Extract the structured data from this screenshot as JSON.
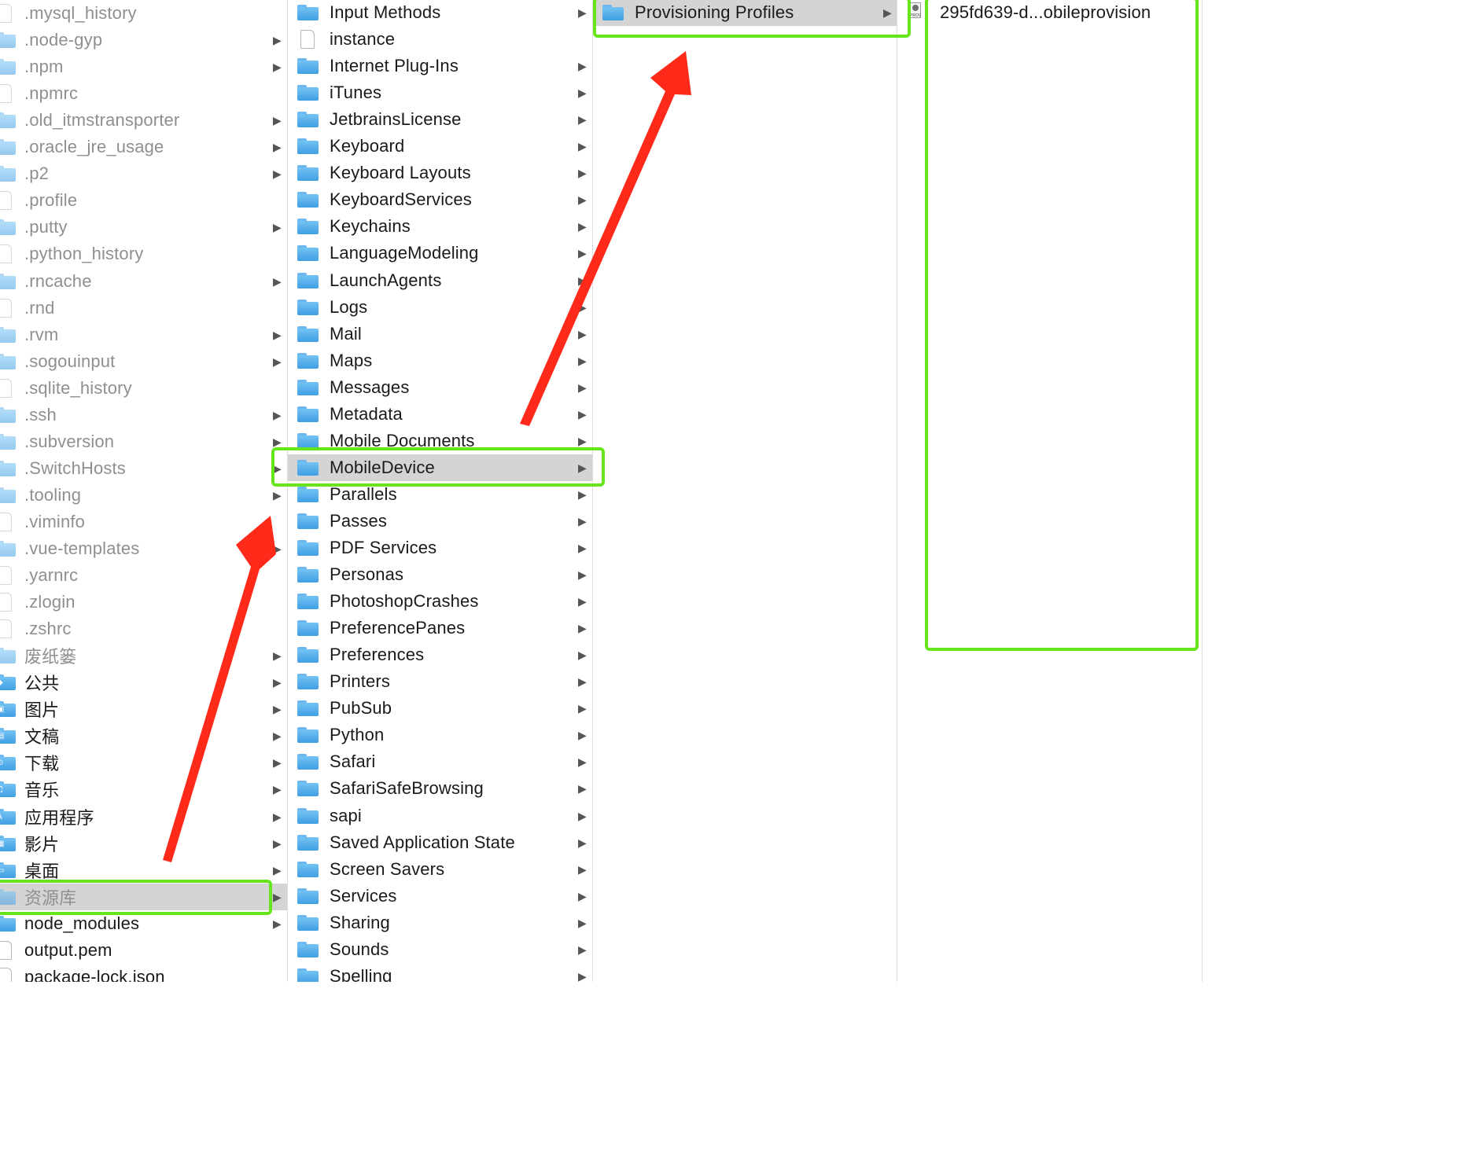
{
  "colors": {
    "highlight_box": "#67e51c",
    "annotation_arrow": "#ff2a1a",
    "selection_background": "#d4d4d4",
    "folder_blue": "#4aa8ea",
    "hidden_item_text": "#8f8f8f"
  },
  "columns": [
    {
      "name": "home-column",
      "items": [
        {
          "label": ".mysql_history",
          "kind": "file",
          "hidden": true,
          "chevron": false
        },
        {
          "label": ".node-gyp",
          "kind": "folder",
          "hidden": true,
          "chevron": true
        },
        {
          "label": ".npm",
          "kind": "folder",
          "hidden": true,
          "chevron": true
        },
        {
          "label": ".npmrc",
          "kind": "file",
          "hidden": true,
          "chevron": false
        },
        {
          "label": ".old_itmstransporter",
          "kind": "folder",
          "hidden": true,
          "chevron": true
        },
        {
          "label": ".oracle_jre_usage",
          "kind": "folder",
          "hidden": true,
          "chevron": true
        },
        {
          "label": ".p2",
          "kind": "folder",
          "hidden": true,
          "chevron": true
        },
        {
          "label": ".profile",
          "kind": "file",
          "hidden": true,
          "chevron": false
        },
        {
          "label": ".putty",
          "kind": "folder",
          "hidden": true,
          "chevron": true
        },
        {
          "label": ".python_history",
          "kind": "file",
          "hidden": true,
          "chevron": false
        },
        {
          "label": ".rncache",
          "kind": "folder",
          "hidden": true,
          "chevron": true
        },
        {
          "label": ".rnd",
          "kind": "file",
          "hidden": true,
          "chevron": false
        },
        {
          "label": ".rvm",
          "kind": "folder",
          "hidden": true,
          "chevron": true
        },
        {
          "label": ".sogouinput",
          "kind": "folder",
          "hidden": true,
          "chevron": true
        },
        {
          "label": ".sqlite_history",
          "kind": "file",
          "hidden": true,
          "chevron": false
        },
        {
          "label": ".ssh",
          "kind": "folder",
          "hidden": true,
          "chevron": true
        },
        {
          "label": ".subversion",
          "kind": "folder",
          "hidden": true,
          "chevron": true
        },
        {
          "label": ".SwitchHosts",
          "kind": "folder",
          "hidden": true,
          "chevron": true
        },
        {
          "label": ".tooling",
          "kind": "folder",
          "hidden": true,
          "chevron": true
        },
        {
          "label": ".viminfo",
          "kind": "file",
          "hidden": true,
          "chevron": false
        },
        {
          "label": ".vue-templates",
          "kind": "folder",
          "hidden": true,
          "chevron": true
        },
        {
          "label": ".yarnrc",
          "kind": "file",
          "hidden": true,
          "chevron": false
        },
        {
          "label": ".zlogin",
          "kind": "file",
          "hidden": true,
          "chevron": false
        },
        {
          "label": ".zshrc",
          "kind": "file",
          "hidden": true,
          "chevron": false
        },
        {
          "label": "废纸篓",
          "kind": "folder",
          "hidden": true,
          "chevron": true
        },
        {
          "label": "公共",
          "kind": "folder",
          "hidden": false,
          "chevron": true,
          "badge": "◆"
        },
        {
          "label": "图片",
          "kind": "folder",
          "hidden": false,
          "chevron": true,
          "badge": "▣"
        },
        {
          "label": "文稿",
          "kind": "folder",
          "hidden": false,
          "chevron": true,
          "badge": "▤"
        },
        {
          "label": "下载",
          "kind": "folder",
          "hidden": false,
          "chevron": true,
          "badge": "⊙"
        },
        {
          "label": "音乐",
          "kind": "folder",
          "hidden": false,
          "chevron": true,
          "badge": "♫"
        },
        {
          "label": "应用程序",
          "kind": "folder",
          "hidden": false,
          "chevron": true,
          "badge": "A"
        },
        {
          "label": "影片",
          "kind": "folder",
          "hidden": false,
          "chevron": true,
          "badge": "▦"
        },
        {
          "label": "桌面",
          "kind": "folder",
          "hidden": false,
          "chevron": true,
          "badge": "▭"
        },
        {
          "label": "资源库",
          "kind": "folder",
          "hidden": true,
          "chevron": true,
          "selected": true
        },
        {
          "label": "node_modules",
          "kind": "folder",
          "hidden": false,
          "chevron": true
        },
        {
          "label": "output.pem",
          "kind": "file",
          "hidden": false,
          "chevron": false
        },
        {
          "label": "package-lock.json",
          "kind": "file",
          "hidden": false,
          "chevron": false
        }
      ]
    },
    {
      "name": "library-column",
      "items": [
        {
          "label": "Input Methods",
          "kind": "folder",
          "chevron": true
        },
        {
          "label": "instance",
          "kind": "file",
          "chevron": false
        },
        {
          "label": "Internet Plug-Ins",
          "kind": "folder",
          "chevron": true
        },
        {
          "label": "iTunes",
          "kind": "folder",
          "chevron": true
        },
        {
          "label": "JetbrainsLicense",
          "kind": "folder",
          "chevron": true
        },
        {
          "label": "Keyboard",
          "kind": "folder",
          "chevron": true
        },
        {
          "label": "Keyboard Layouts",
          "kind": "folder",
          "chevron": true
        },
        {
          "label": "KeyboardServices",
          "kind": "folder",
          "chevron": true
        },
        {
          "label": "Keychains",
          "kind": "folder",
          "chevron": true
        },
        {
          "label": "LanguageModeling",
          "kind": "folder",
          "chevron": true
        },
        {
          "label": "LaunchAgents",
          "kind": "folder",
          "chevron": true
        },
        {
          "label": "Logs",
          "kind": "folder",
          "chevron": true
        },
        {
          "label": "Mail",
          "kind": "folder",
          "chevron": true
        },
        {
          "label": "Maps",
          "kind": "folder",
          "chevron": true
        },
        {
          "label": "Messages",
          "kind": "folder",
          "chevron": true
        },
        {
          "label": "Metadata",
          "kind": "folder",
          "chevron": true
        },
        {
          "label": "Mobile Documents",
          "kind": "folder",
          "chevron": true
        },
        {
          "label": "MobileDevice",
          "kind": "folder",
          "chevron": true,
          "selected": true
        },
        {
          "label": "Parallels",
          "kind": "folder",
          "chevron": true
        },
        {
          "label": "Passes",
          "kind": "folder",
          "chevron": true
        },
        {
          "label": "PDF Services",
          "kind": "folder",
          "chevron": true
        },
        {
          "label": "Personas",
          "kind": "folder",
          "chevron": true
        },
        {
          "label": "PhotoshopCrashes",
          "kind": "folder",
          "chevron": true
        },
        {
          "label": "PreferencePanes",
          "kind": "folder",
          "chevron": true
        },
        {
          "label": "Preferences",
          "kind": "folder",
          "chevron": true
        },
        {
          "label": "Printers",
          "kind": "folder",
          "chevron": true
        },
        {
          "label": "PubSub",
          "kind": "folder",
          "chevron": true
        },
        {
          "label": "Python",
          "kind": "folder",
          "chevron": true
        },
        {
          "label": "Safari",
          "kind": "folder",
          "chevron": true
        },
        {
          "label": "SafariSafeBrowsing",
          "kind": "folder",
          "chevron": true
        },
        {
          "label": "sapi",
          "kind": "folder",
          "chevron": true
        },
        {
          "label": "Saved Application State",
          "kind": "folder",
          "chevron": true
        },
        {
          "label": "Screen Savers",
          "kind": "folder",
          "chevron": true
        },
        {
          "label": "Services",
          "kind": "folder",
          "chevron": true
        },
        {
          "label": "Sharing",
          "kind": "folder",
          "chevron": true
        },
        {
          "label": "Sounds",
          "kind": "folder",
          "chevron": true
        },
        {
          "label": "Spelling",
          "kind": "folder",
          "chevron": true
        }
      ]
    },
    {
      "name": "mobiledevice-column",
      "items": [
        {
          "label": "Provisioning Profiles",
          "kind": "folder",
          "chevron": true,
          "selected": true
        }
      ]
    },
    {
      "name": "provisioning-profiles-column",
      "items": [
        {
          "label": "295fd639-d...obileprovision",
          "kind": "provision",
          "chevron": false,
          "icon_text": "PROV"
        }
      ]
    }
  ]
}
